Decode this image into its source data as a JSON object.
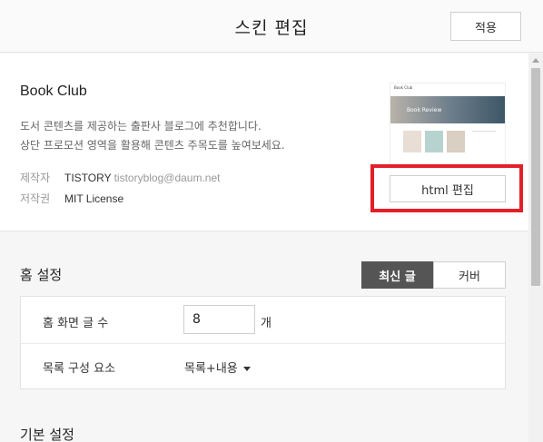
{
  "header": {
    "title": "스킨 편집",
    "apply_label": "적용"
  },
  "skin": {
    "name": "Book Club",
    "description_line1": "도서 콘텐츠를 제공하는 출판사 블로그에 추천합니다.",
    "description_line2": "상단 프로모션 영역을 활용해 콘텐츠 주목도를 높여보세요.",
    "maker_label": "제작자",
    "maker_name": "TISTORY",
    "maker_email": "tistoryblog@daum.net",
    "license_label": "저작권",
    "license_value": "MIT License",
    "html_edit_label": "html 편집",
    "thumbnail": {
      "site_title": "Book Club",
      "hero_text": "Book Review"
    }
  },
  "home_settings": {
    "title": "홈 설정",
    "tabs": [
      {
        "label": "최신 글",
        "active": true
      },
      {
        "label": "커버",
        "active": false
      }
    ],
    "post_count_label": "홈 화면 글 수",
    "post_count_value": "8",
    "post_count_unit": "개",
    "list_composition_label": "목록 구성 요소",
    "list_composition_value": "목록+내용"
  },
  "basic_settings": {
    "title": "기본 설정"
  },
  "colors": {
    "highlight": "#e3202a",
    "active_tab_bg": "#555555"
  }
}
